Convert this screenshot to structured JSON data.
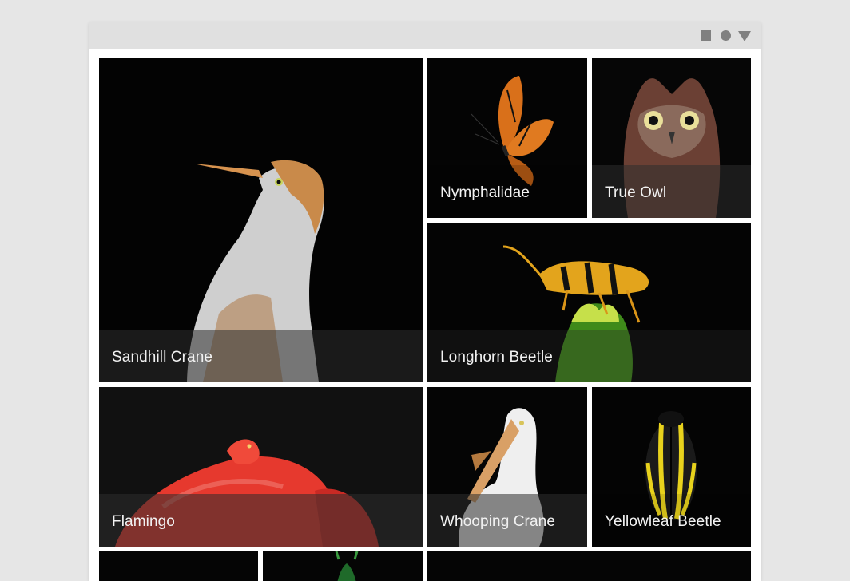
{
  "window": {
    "controls": [
      "square-icon",
      "circle-icon",
      "triangle-icon"
    ]
  },
  "tiles": [
    {
      "label": "Sandhill Crane"
    },
    {
      "label": "Nymphalidae"
    },
    {
      "label": "True Owl"
    },
    {
      "label": "Longhorn Beetle"
    },
    {
      "label": "Flamingo"
    },
    {
      "label": "Whooping Crane"
    },
    {
      "label": "Yellowleaf Beetle"
    }
  ],
  "colors": {
    "tile_background": "#050505",
    "titlebar": "#e0e0e0",
    "control_icons": "#808080",
    "caption_text": "#f2f2f2"
  }
}
